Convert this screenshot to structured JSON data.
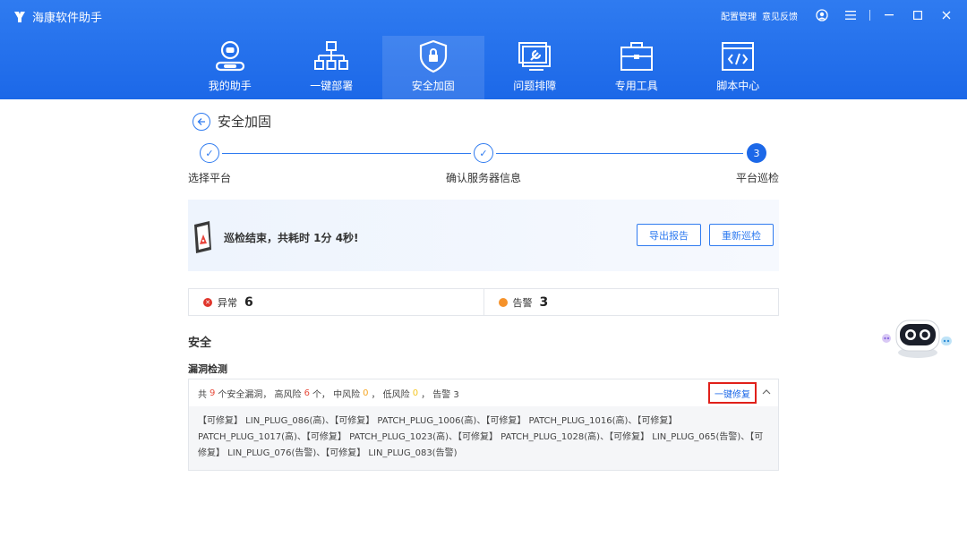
{
  "window": {
    "title": "海康软件助手",
    "links": [
      "配置管理",
      "意见反馈"
    ]
  },
  "nav": [
    {
      "label": "我的助手",
      "icon": "assistant-icon"
    },
    {
      "label": "一键部署",
      "icon": "deploy-icon"
    },
    {
      "label": "安全加固",
      "icon": "shield-icon",
      "active": true
    },
    {
      "label": "问题排障",
      "icon": "troubleshoot-icon"
    },
    {
      "label": "专用工具",
      "icon": "toolbox-icon"
    },
    {
      "label": "脚本中心",
      "icon": "script-icon"
    }
  ],
  "page": {
    "title": "安全加固"
  },
  "steps": [
    {
      "label": "选择平台",
      "state": "done"
    },
    {
      "label": "确认服务器信息",
      "state": "done"
    },
    {
      "label": "平台巡检",
      "state": "current",
      "number": "3"
    }
  ],
  "result": {
    "text": "巡检结束，共耗时 1分 4秒!",
    "export_label": "导出报告",
    "rescan_label": "重新巡检"
  },
  "stats": [
    {
      "label": "异常",
      "value": "6",
      "color": "#e0362c"
    },
    {
      "label": "告警",
      "value": "3",
      "color": "#f5922a"
    }
  ],
  "section": {
    "title": "安全",
    "subtitle": "漏洞检测"
  },
  "vuln": {
    "summary": {
      "p1": "共",
      "total": "9",
      "p2": "个安全漏洞，  高风险",
      "high": "6",
      "p3": "个，  中风险",
      "mid": "0",
      "p4": "，  低风险",
      "low": "0",
      "p5": "，  告警 3"
    },
    "fix_label": "一键修复",
    "details": "【可修复】 LIN_PLUG_086(高)、【可修复】 PATCH_PLUG_1006(高)、【可修复】 PATCH_PLUG_1016(高)、【可修复】 PATCH_PLUG_1017(高)、【可修复】 PATCH_PLUG_1023(高)、【可修复】 PATCH_PLUG_1028(高)、【可修复】 LIN_PLUG_065(告警)、【可修复】 LIN_PLUG_076(告警)、【可修复】 LIN_PLUG_083(告警)"
  },
  "colors": {
    "brand": "#1c68e8",
    "danger": "#e0201a"
  }
}
